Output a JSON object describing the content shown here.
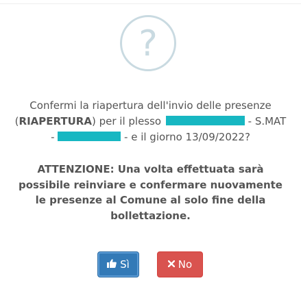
{
  "dialog": {
    "icon": "question-mark-icon",
    "icon_glyph": "?",
    "message": {
      "line1": "Confermi la riapertura dell'invio delle presenze",
      "line2_open": "(",
      "line2_bold": "RIAPERTURA",
      "line2_mid": ") per il plesso ",
      "line2_end": " - S.MAT",
      "line3_start": "- ",
      "line3_end": " - e il giorno 13/09/2022?"
    },
    "warning": {
      "line1": "ATTENZIONE: Una volta effettuata sarà",
      "line2": "possibile reinviare e confermare nuovamente",
      "line3": "le presenze al Comune al solo fine della",
      "line4": "bollettazione."
    },
    "buttons": {
      "yes_label": "Sì",
      "yes_icon": "thumbs-up-icon",
      "no_label": "No",
      "no_icon": "close-icon"
    },
    "colors": {
      "yes_button": "#337ab7",
      "no_button": "#d9534f",
      "redaction": "#17b7c2",
      "icon": "#c9dae1"
    }
  }
}
